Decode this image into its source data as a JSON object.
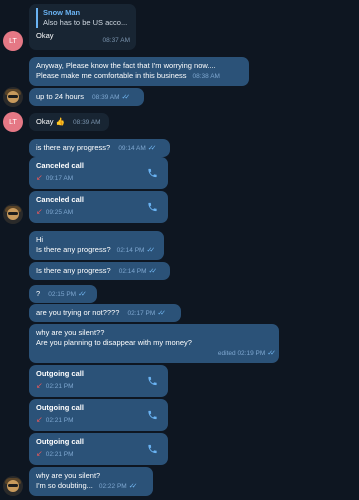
{
  "reply": {
    "name": "Snow Man",
    "text": "Also has to be US acco..."
  },
  "avatars": {
    "lt": "LT"
  },
  "messages": {
    "m1": {
      "text": "Okay",
      "time": "08:37 AM"
    },
    "m2": {
      "line1": "Anyway, Please know the fact that I'm worrying now....",
      "line2": "Please make me comfortable in this business",
      "time": "08:38 AM"
    },
    "m3": {
      "text": "up to 24 hours",
      "time": "08:39 AM"
    },
    "m4": {
      "text": "Okay 👍",
      "time": "08:39 AM"
    },
    "m5": {
      "text": "is there any progress?",
      "time": "09:14 AM"
    },
    "c1": {
      "title": "Canceled call",
      "time": "09:17 AM"
    },
    "c2": {
      "title": "Canceled call",
      "time": "09:25 AM"
    },
    "m6": {
      "line1": "Hi",
      "line2": "Is there any progress?",
      "time": "02:14 PM"
    },
    "m7": {
      "text": "Is there any progress?",
      "time": "02:14 PM"
    },
    "m8": {
      "text": "?",
      "time": "02:15 PM"
    },
    "m9": {
      "text": "are you trying or not????",
      "time": "02:17 PM"
    },
    "m10": {
      "line1": "why are you silent??",
      "line2": "Are you planning to disappear with my money?",
      "time": "edited 02:19 PM"
    },
    "c3": {
      "title": "Outgoing call",
      "time": "02:21 PM"
    },
    "c4": {
      "title": "Outgoing call",
      "time": "02:21 PM"
    },
    "c5": {
      "title": "Outgoing call",
      "time": "02:21 PM"
    },
    "m11": {
      "line1": "why are you silent?",
      "line2": "I'm so doubting...",
      "time": "02:22 PM"
    }
  },
  "colors": {
    "background": "#0e1621",
    "incoming": "#182533",
    "outgoing": "#2b5278",
    "accent": "#6ab3f3",
    "missed": "#e2585c"
  },
  "icons": {
    "call": "phone-icon",
    "status": "double-check-icon",
    "call_direction": "call-arrow-icon"
  }
}
